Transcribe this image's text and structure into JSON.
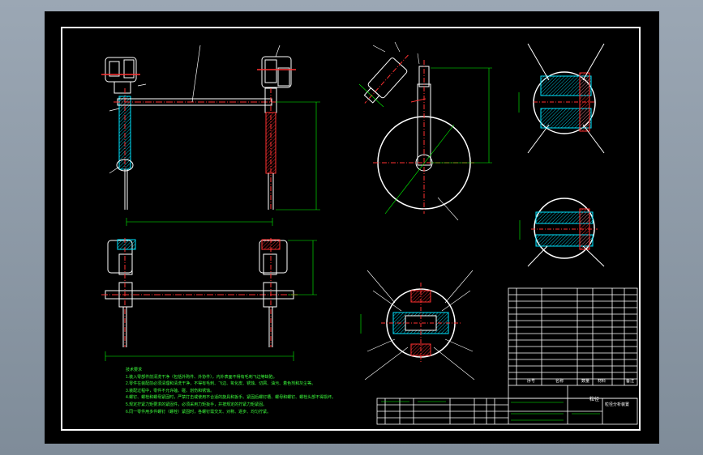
{
  "notes": {
    "lines": [
      "技术要求",
      "1.装入零部件前清洗干净（包括外购件、外协件），内外表面不得有毛刺飞边等缺陷。",
      "2.零件在装配前必须清理和清洗干净，不得有毛刺、飞边、氧化皮、锈蚀、切屑、油污、着色剂和灰尘等。",
      "3.装配过程中，零件不允许磕、碰、划伤和锈蚀。",
      "4.螺钉、螺栓和螺母紧固时，严禁打击或使用不合适的旋具和扳手。紧固后螺钉槽、螺母和螺钉、螺栓头部不得损坏。",
      "5.规定拧紧力矩要求的紧固件，必须采用力矩扳手，并按规定的拧紧力矩紧固。",
      "6.同一零件用多件螺钉（螺栓）紧固时，各螺钉需交叉、对称、逐步、均匀拧紧。"
    ]
  },
  "title_block": {
    "name": "粒径",
    "drawing_no": "粒径分析装置",
    "table_headers": [
      "序号",
      "名称",
      "数量",
      "材料",
      "备注"
    ]
  },
  "colors": {
    "frame": "#ffffff",
    "part_red": "#ff3030",
    "hatch_cyan": "#00e5ff",
    "dimension_green": "#00ff00",
    "leader_yellow": "#ffff00"
  }
}
